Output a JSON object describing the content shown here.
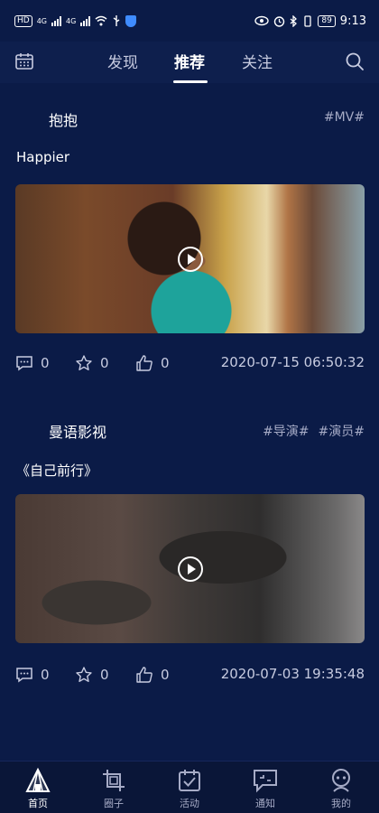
{
  "status_bar": {
    "left_chip": "HD",
    "network_1": "4G",
    "network_2": "4G",
    "battery": "89",
    "time": "9:13"
  },
  "top_nav": {
    "tabs": [
      {
        "label": "发现",
        "active": false
      },
      {
        "label": "推荐",
        "active": true
      },
      {
        "label": "关注",
        "active": false
      }
    ],
    "left_icon": "calendar-icon",
    "right_icon": "search-icon"
  },
  "posts": [
    {
      "author": "抱抱",
      "tags": [
        "#MV#"
      ],
      "title": "Happier",
      "comments": "0",
      "favorites": "0",
      "likes": "0",
      "time": "2020-07-15 06:50:32"
    },
    {
      "author": "曼语影视",
      "tags": [
        "#导演#",
        "#演员#"
      ],
      "title": "《自己前行》",
      "comments": "0",
      "favorites": "0",
      "likes": "0",
      "time": "2020-07-03 19:35:48"
    }
  ],
  "bottom_nav": {
    "items": [
      {
        "label": "首页",
        "icon": "home-tent-icon",
        "active": true
      },
      {
        "label": "圈子",
        "icon": "crop-icon",
        "active": false
      },
      {
        "label": "活动",
        "icon": "activity-check-icon",
        "active": false
      },
      {
        "label": "通知",
        "icon": "notification-chat-icon",
        "active": false
      },
      {
        "label": "我的",
        "icon": "profile-icon",
        "active": false
      }
    ]
  },
  "colors": {
    "background": "#0b1b47",
    "top_nav": "#0e1f4d",
    "bottom_nav": "#0a1638",
    "muted_text": "#a6abc6"
  }
}
